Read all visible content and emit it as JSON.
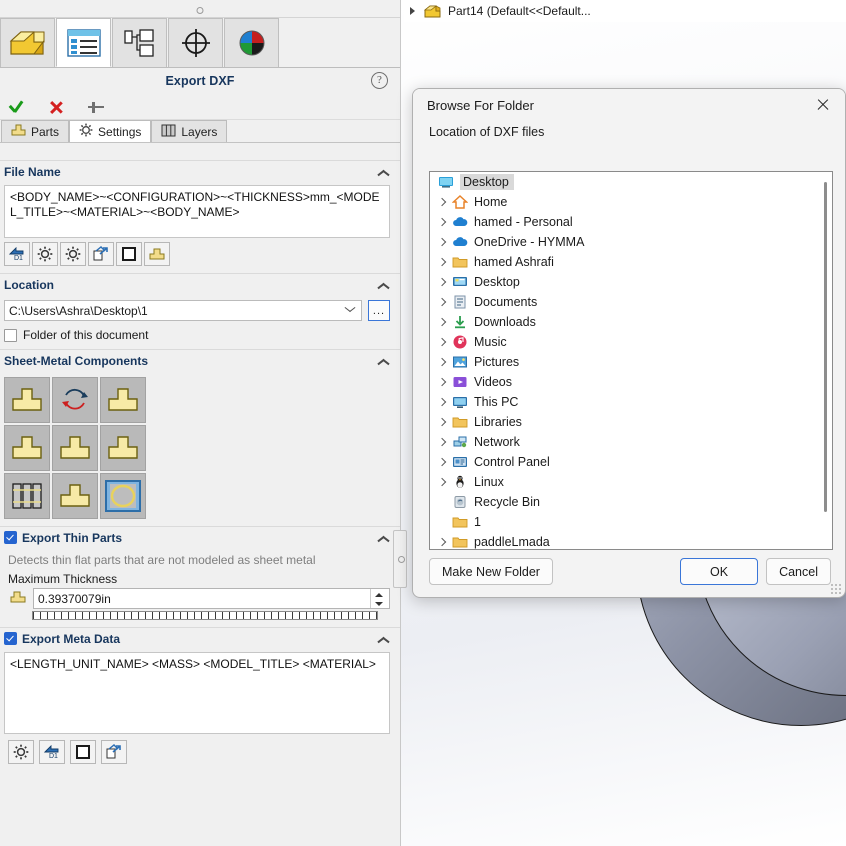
{
  "feature_tree": {
    "root_label": "Part14  (Default<<Default...",
    "expander_icon": "triangle-right-icon",
    "part_icon": "solidworks-part-icon"
  },
  "left_panel": {
    "command_tabs": [
      {
        "name": "part-features-tab",
        "icon": "yellow-part-icon",
        "active": false
      },
      {
        "name": "property-manager-tab",
        "icon": "list-properties-icon",
        "active": true
      },
      {
        "name": "configuration-manager-tab",
        "icon": "configuration-tree-icon",
        "active": false
      },
      {
        "name": "dimxpert-manager-tab",
        "icon": "crosshair-target-icon",
        "active": false
      },
      {
        "name": "display-manager-tab",
        "icon": "color-sphere-icon",
        "active": false
      }
    ],
    "title": "Export DXF",
    "help_icon": "question-mark-icon",
    "actions": [
      {
        "name": "accept-button",
        "icon": "green-check-icon"
      },
      {
        "name": "cancel-button",
        "icon": "red-x-icon"
      },
      {
        "name": "pin-button",
        "icon": "pushpin-icon"
      }
    ],
    "sub_tabs": [
      {
        "label": "Parts",
        "icon": "sheet-metal-part-icon",
        "active": false
      },
      {
        "label": "Settings",
        "icon": "gear-icon",
        "active": true
      },
      {
        "label": "Layers",
        "icon": "layers-icon",
        "active": false
      }
    ],
    "sections": {
      "file_name": {
        "title": "File Name",
        "has_checkbox": false,
        "value": "<BODY_NAME>~<CONFIGURATION>~<THICKNESS>mm_<MODEL_TITLE>~<MATERIAL>~<BODY_NAME>",
        "buttons": [
          {
            "name": "dimension-variable-button",
            "icon": "d1-arrow-icon"
          },
          {
            "name": "settings-gear-button-1",
            "icon": "gear-icon"
          },
          {
            "name": "settings-gear-button-2",
            "icon": "gear-icon"
          },
          {
            "name": "transform-export-button",
            "icon": "export-arrows-icon"
          },
          {
            "name": "square-outline-button",
            "icon": "square-outline-icon"
          },
          {
            "name": "sheet-metal-button",
            "icon": "sheet-metal-part-icon"
          }
        ]
      },
      "location": {
        "title": "Location",
        "path": "C:\\Users\\Ashra\\Desktop\\1",
        "browse_label": "...",
        "folder_of_document_label": "Folder of this document",
        "folder_of_document_checked": false
      },
      "sheet_metal_components": {
        "title": "Sheet-Metal Components",
        "cells": [
          {
            "name": "flat-pattern-option-1",
            "icon": "sheet-metal-part-icon"
          },
          {
            "name": "flat-pattern-option-2",
            "icon": "rotate-arrows-icon"
          },
          {
            "name": "flat-pattern-option-3",
            "icon": "sheet-metal-part-icon"
          },
          {
            "name": "flat-pattern-option-4",
            "icon": "sheet-metal-part-icon"
          },
          {
            "name": "flat-pattern-option-5",
            "icon": "sheet-metal-part-icon"
          },
          {
            "name": "flat-pattern-option-6",
            "icon": "sheet-metal-part-icon"
          },
          {
            "name": "flat-pattern-option-7",
            "icon": "multi-sheet-icon"
          },
          {
            "name": "flat-pattern-option-8",
            "icon": "sheet-metal-part-icon"
          },
          {
            "name": "flat-pattern-option-9",
            "icon": "circle-hole-icon"
          }
        ]
      },
      "export_thin_parts": {
        "title": "Export Thin Parts",
        "checked": true,
        "hint": "Detects thin flat parts that are not modeled as sheet metal",
        "max_thickness_label": "Maximum Thickness",
        "max_thickness_value": "0.39370079in"
      },
      "export_meta_data": {
        "title": "Export Meta Data",
        "checked": true,
        "value": "<LENGTH_UNIT_NAME> <MASS> <MODEL_TITLE> <MATERIAL>"
      }
    },
    "bottom_buttons": [
      {
        "name": "settings-gear-button",
        "icon": "gear-icon"
      },
      {
        "name": "dimension-variable-button",
        "icon": "d1-arrow-icon"
      },
      {
        "name": "square-outline-button",
        "icon": "square-outline-icon"
      },
      {
        "name": "transform-export-button",
        "icon": "export-arrows-icon"
      }
    ]
  },
  "dialog": {
    "title": "Browse For Folder",
    "close_icon": "close-icon",
    "subtitle": "Location of DXF files",
    "tree": [
      {
        "label": "Desktop",
        "icon": "desktop-icon",
        "expandable": false,
        "selected": true,
        "indent": 0
      },
      {
        "label": "Home",
        "icon": "home-icon",
        "expandable": true,
        "selected": false,
        "indent": 1
      },
      {
        "label": "hamed - Personal",
        "icon": "onedrive-icon",
        "expandable": true,
        "selected": false,
        "indent": 1
      },
      {
        "label": "OneDrive - HYMMA",
        "icon": "onedrive-icon",
        "expandable": true,
        "selected": false,
        "indent": 1
      },
      {
        "label": "hamed Ashrafi",
        "icon": "folder-icon",
        "expandable": true,
        "selected": false,
        "indent": 1
      },
      {
        "label": "Desktop",
        "icon": "desktop-folder-icon",
        "expandable": true,
        "selected": false,
        "indent": 1
      },
      {
        "label": "Documents",
        "icon": "documents-icon",
        "expandable": true,
        "selected": false,
        "indent": 1
      },
      {
        "label": "Downloads",
        "icon": "downloads-icon",
        "expandable": true,
        "selected": false,
        "indent": 1
      },
      {
        "label": "Music",
        "icon": "music-icon",
        "expandable": true,
        "selected": false,
        "indent": 1
      },
      {
        "label": "Pictures",
        "icon": "pictures-icon",
        "expandable": true,
        "selected": false,
        "indent": 1
      },
      {
        "label": "Videos",
        "icon": "videos-icon",
        "expandable": true,
        "selected": false,
        "indent": 1
      },
      {
        "label": "This PC",
        "icon": "this-pc-icon",
        "expandable": true,
        "selected": false,
        "indent": 1
      },
      {
        "label": "Libraries",
        "icon": "folder-icon",
        "expandable": true,
        "selected": false,
        "indent": 1
      },
      {
        "label": "Network",
        "icon": "network-icon",
        "expandable": true,
        "selected": false,
        "indent": 1
      },
      {
        "label": "Control Panel",
        "icon": "control-panel-icon",
        "expandable": true,
        "selected": false,
        "indent": 1
      },
      {
        "label": "Linux",
        "icon": "linux-penguin-icon",
        "expandable": true,
        "selected": false,
        "indent": 1
      },
      {
        "label": "Recycle Bin",
        "icon": "recycle-bin-icon",
        "expandable": false,
        "selected": false,
        "indent": 1
      },
      {
        "label": "1",
        "icon": "folder-icon",
        "expandable": false,
        "selected": false,
        "indent": 1
      },
      {
        "label": "paddleLmada",
        "icon": "folder-icon",
        "expandable": true,
        "selected": false,
        "indent": 1
      }
    ],
    "buttons": {
      "make_new_folder": "Make New Folder",
      "ok": "OK",
      "cancel": "Cancel"
    }
  },
  "colors": {
    "accent_blue": "#2564cf",
    "title_blue": "#17365d",
    "check_green": "#1a9b1a",
    "cancel_red": "#d42020",
    "sheet_metal_yellow": "#f5e9a8"
  }
}
